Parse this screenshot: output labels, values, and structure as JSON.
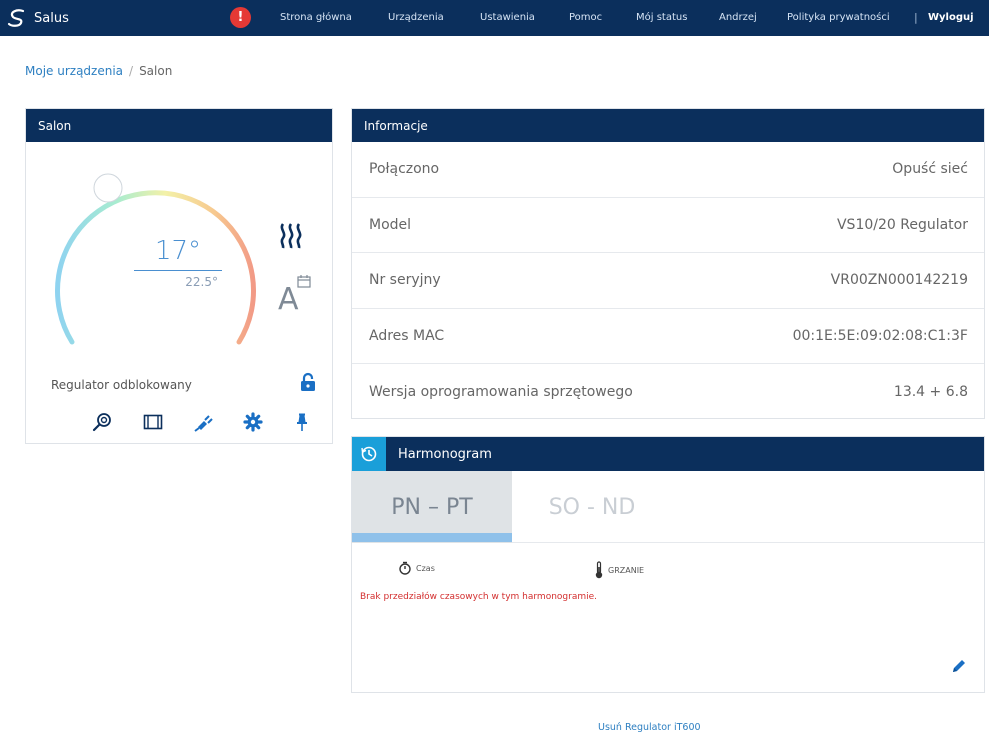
{
  "app": {
    "brand": "Salus",
    "alert_icon": "exclamation-icon",
    "alert_text": "!"
  },
  "nav": {
    "items": [
      "Strona główna",
      "Urządzenia",
      "Ustawienia",
      "Pomoc",
      "Mój status",
      "Andrzej",
      "Polityka prywatności"
    ],
    "separator": "|",
    "logout": "Wyloguj"
  },
  "breadcrumb": {
    "parent": "Moje urządzenia",
    "separator": "/",
    "current": "Salon"
  },
  "thermostat": {
    "title": "Salon",
    "set_temperature": "17°",
    "current_temperature": "22.5°",
    "lock_status": "Regulator odblokowany",
    "icons": [
      "heating-icon",
      "auto-schedule-icon",
      "unlock-icon",
      "search-icon",
      "film-icon",
      "plug-icon",
      "gear-icon",
      "pin-icon"
    ]
  },
  "info": {
    "title": "Informacje",
    "rows": [
      {
        "label": "Połączono",
        "value": "Opuść sieć"
      },
      {
        "label": "Model",
        "value": "VS10/20 Regulator"
      },
      {
        "label": "Nr seryjny",
        "value": "VR00ZN000142219"
      },
      {
        "label": "Adres MAC",
        "value": "00:1E:5E:09:02:08:C1:3F"
      },
      {
        "label": "Wersja oprogramowania sprzętowego",
        "value": "13.4 + 6.8"
      }
    ]
  },
  "schedule": {
    "title": "Harmonogram",
    "tabs": [
      "PN – PT",
      "SO - ND"
    ],
    "active_tab": 0,
    "col_time": "Czas",
    "col_heat": "GRZANIE",
    "empty_message": "Brak przedziałów czasowych w tym harmonogramie."
  },
  "footer": {
    "remove_link": "Usuń Regulator iT600"
  },
  "colors": {
    "header": "#0b2f5c",
    "accent": "#2d7fc1",
    "error": "#d32f2f",
    "schedule_icon_bg": "#1a9fd9"
  }
}
